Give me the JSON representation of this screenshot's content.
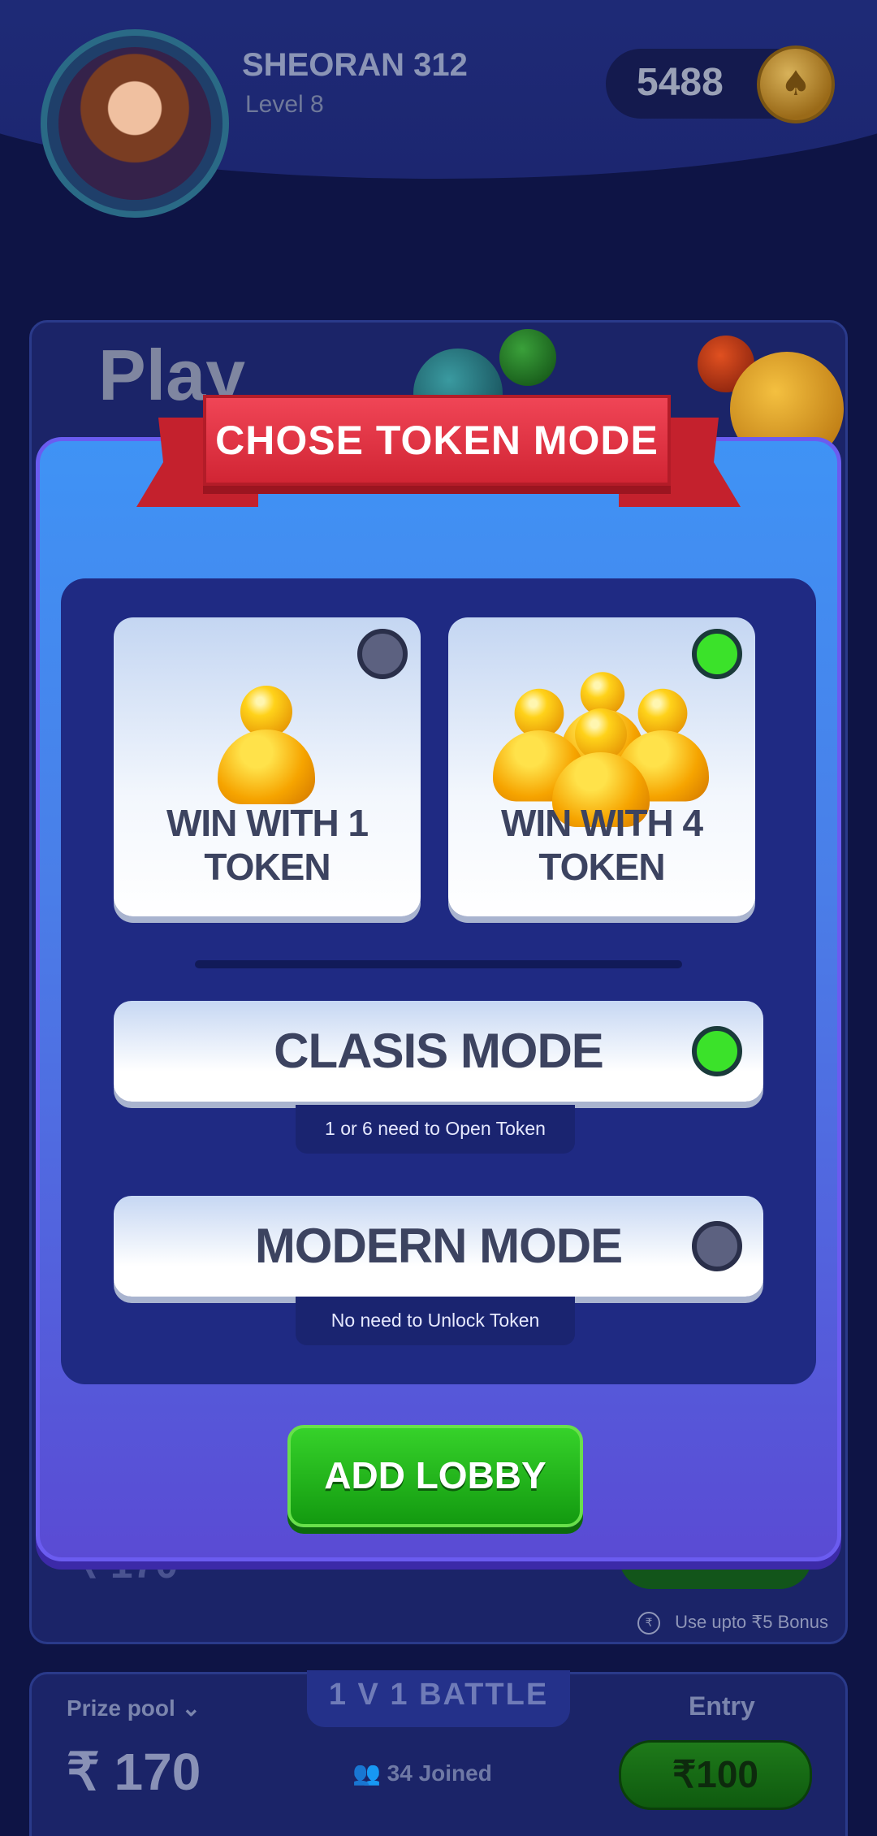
{
  "profile": {
    "name": "SHEORAN 312",
    "level": "Level 8",
    "coins": "5488"
  },
  "background": {
    "play_title": "Play",
    "prize_label": "Prize pool",
    "prize_value": "₹ 170",
    "upper_prize_partial": "₹ 170",
    "battle_title": "1 V 1 BATTLE",
    "joined": "34 Joined",
    "entry_label": "Entry",
    "entry_value": "₹100",
    "bonus_note": "Use upto ₹5 Bonus"
  },
  "modal": {
    "title": "CHOSE TOKEN MODE",
    "token_options": [
      {
        "label": "WIN WITH 1 TOKEN",
        "selected": false
      },
      {
        "label": "WIN WITH 4 TOKEN",
        "selected": true
      }
    ],
    "modes": [
      {
        "label": "CLASIS MODE",
        "hint": "1 or 6 need to Open Token",
        "selected": true
      },
      {
        "label": "MODERN MODE",
        "hint": "No need to Unlock Token",
        "selected": false
      }
    ],
    "action": "ADD LOBBY"
  },
  "colors": {
    "modal_top": "#3f93f5",
    "modal_bottom": "#5a4bd4",
    "ribbon": "#d12534",
    "selected": "#3be22a",
    "button_green": "#28b81e"
  }
}
